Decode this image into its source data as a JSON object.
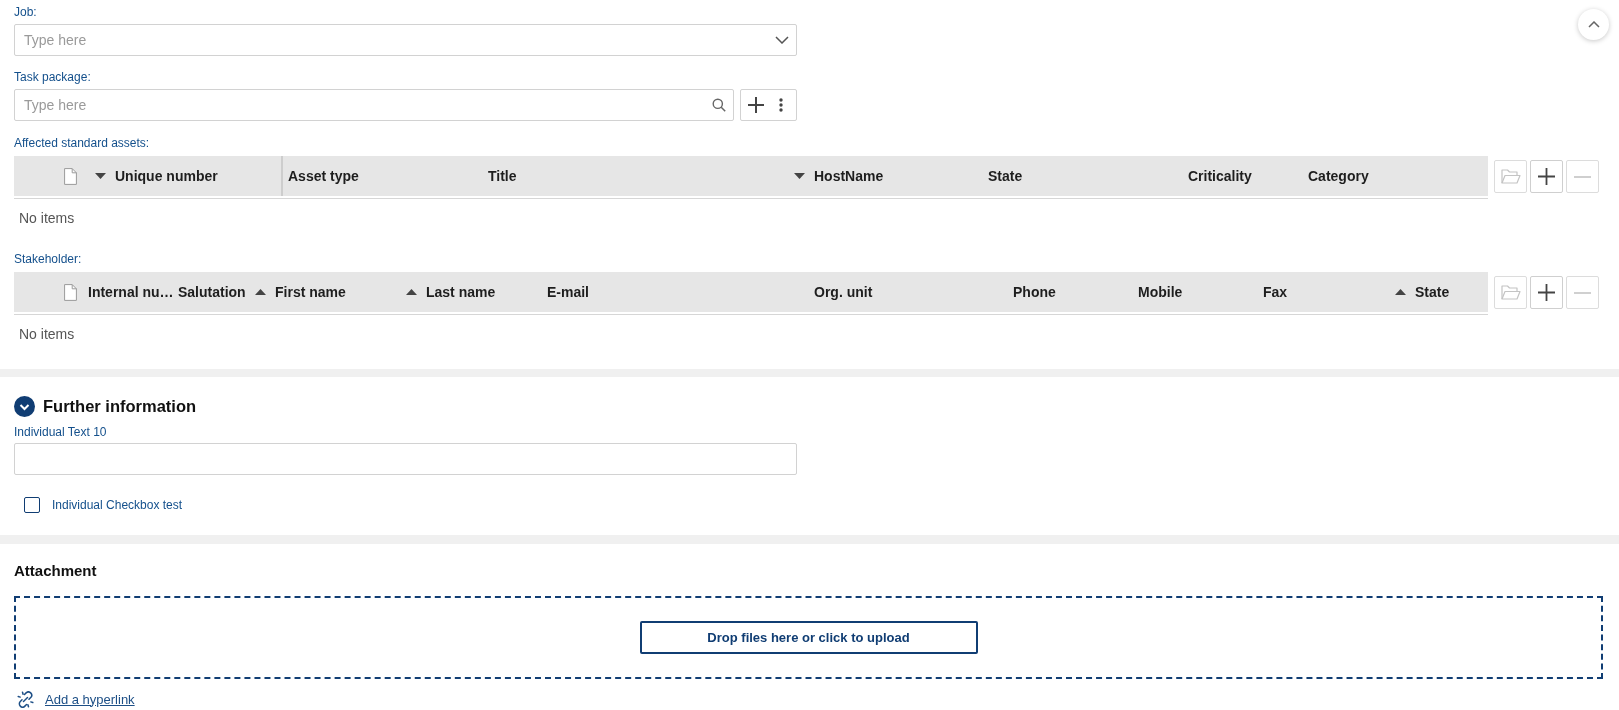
{
  "fields": [
    {
      "kind": "select",
      "label": "Job:",
      "placeholder": "Type here"
    },
    {
      "kind": "search",
      "label": "Task package:",
      "placeholder": "Type here"
    }
  ],
  "tables": [
    {
      "label": "Affected standard assets:",
      "columns": [
        {
          "title": "Unique number",
          "sorted_ascending": false,
          "sorted_descending": true
        },
        {
          "title": "Asset type",
          "sorted_ascending": false,
          "sorted_descending": false
        },
        {
          "title": "Title",
          "sorted_ascending": false,
          "sorted_descending": false
        },
        {
          "title": "HostName",
          "sorted_ascending": false,
          "sorted_descending": true
        },
        {
          "title": "State",
          "sorted_ascending": false,
          "sorted_descending": false
        },
        {
          "title": "Criticality",
          "sorted_ascending": false,
          "sorted_descending": false
        },
        {
          "title": "Category",
          "sorted_ascending": false,
          "sorted_descending": false
        }
      ],
      "empty_text": "No items",
      "toolbar": [
        {
          "kind": "open",
          "disabled": true
        },
        {
          "kind": "add",
          "disabled": false
        },
        {
          "kind": "remove",
          "disabled": true
        }
      ]
    },
    {
      "label": "Stakeholder:",
      "columns": [
        {
          "title": "Internal nu…",
          "sorted_ascending": false,
          "sorted_descending": false
        },
        {
          "title": "Salutation",
          "sorted_ascending": false,
          "sorted_descending": false
        },
        {
          "title": "First name",
          "sorted_ascending": true,
          "sorted_descending": false
        },
        {
          "title": "Last name",
          "sorted_ascending": true,
          "sorted_descending": false
        },
        {
          "title": "E-mail",
          "sorted_ascending": false,
          "sorted_descending": false
        },
        {
          "title": "Org. unit",
          "sorted_ascending": false,
          "sorted_descending": false
        },
        {
          "title": "Phone",
          "sorted_ascending": false,
          "sorted_descending": false
        },
        {
          "title": "Mobile",
          "sorted_ascending": false,
          "sorted_descending": false
        },
        {
          "title": "Fax",
          "sorted_ascending": false,
          "sorted_descending": false
        },
        {
          "title": "State",
          "sorted_ascending": true,
          "sorted_descending": false
        }
      ],
      "empty_text": "No items",
      "toolbar": [
        {
          "kind": "open",
          "disabled": true
        },
        {
          "kind": "add",
          "disabled": false
        },
        {
          "kind": "remove",
          "disabled": true
        }
      ]
    }
  ],
  "further_information": {
    "title": "Further information",
    "expanded": true,
    "text_field": {
      "label": "Individual Text 10"
    },
    "checkbox": {
      "label": "Individual Checkbox test",
      "checked": false
    }
  },
  "attachment": {
    "title": "Attachment",
    "upload_button": "Drop files here or click to upload",
    "link": "Add a hyperlink"
  }
}
